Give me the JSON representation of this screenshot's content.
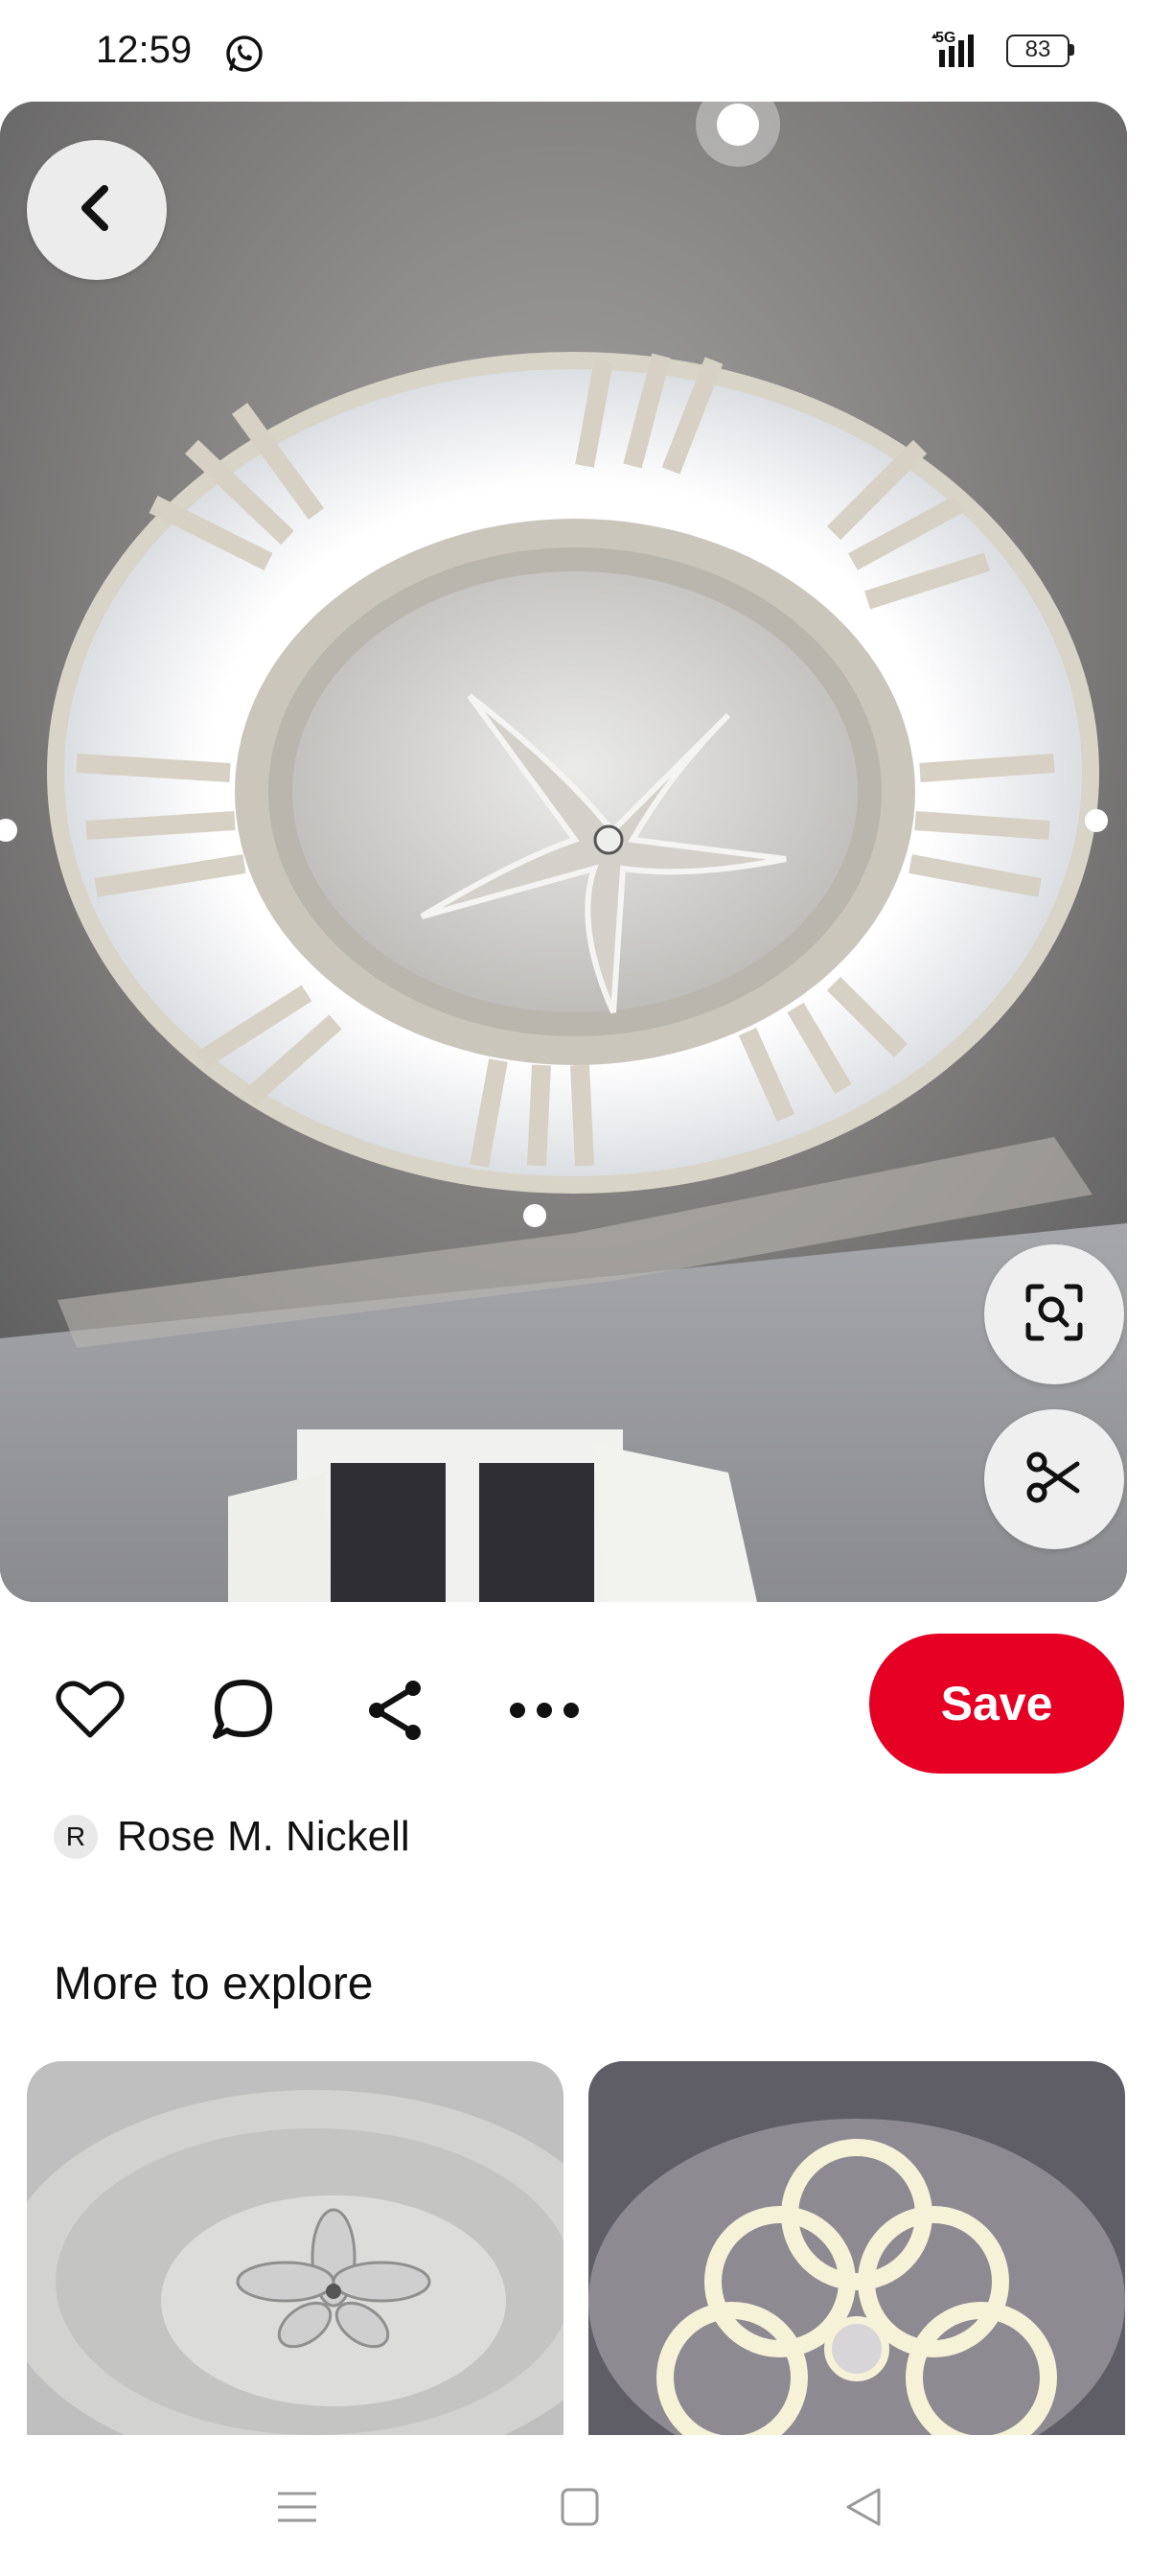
{
  "status_bar": {
    "time": "12:59",
    "network_label": "5G",
    "battery_level": "83",
    "icons": [
      "whatsapp-icon",
      "signal-icon",
      "battery-icon"
    ]
  },
  "pin": {
    "image_subject": "white false ceiling with backlit circular frame and star-shaped centerpiece",
    "icons": [
      "back-arrow-icon",
      "visual-search-icon",
      "scissors-icon"
    ]
  },
  "actions": {
    "icons": [
      "heart-icon",
      "comment-icon",
      "share-icon",
      "more-icon"
    ],
    "save_label": "Save"
  },
  "creator": {
    "avatar_initial": "R",
    "name": "Rose M. Nickell"
  },
  "more_to_explore": {
    "title": "More to explore",
    "items": [
      {
        "subject": "white ceiling with flower medallion"
      },
      {
        "subject": "backlit scalloped ceiling design"
      }
    ]
  },
  "nav_bar": {
    "icons": [
      "menu-icon",
      "home-square-icon",
      "back-triangle-icon"
    ]
  },
  "colors": {
    "save_button": "#e60023",
    "background": "#ffffff"
  }
}
